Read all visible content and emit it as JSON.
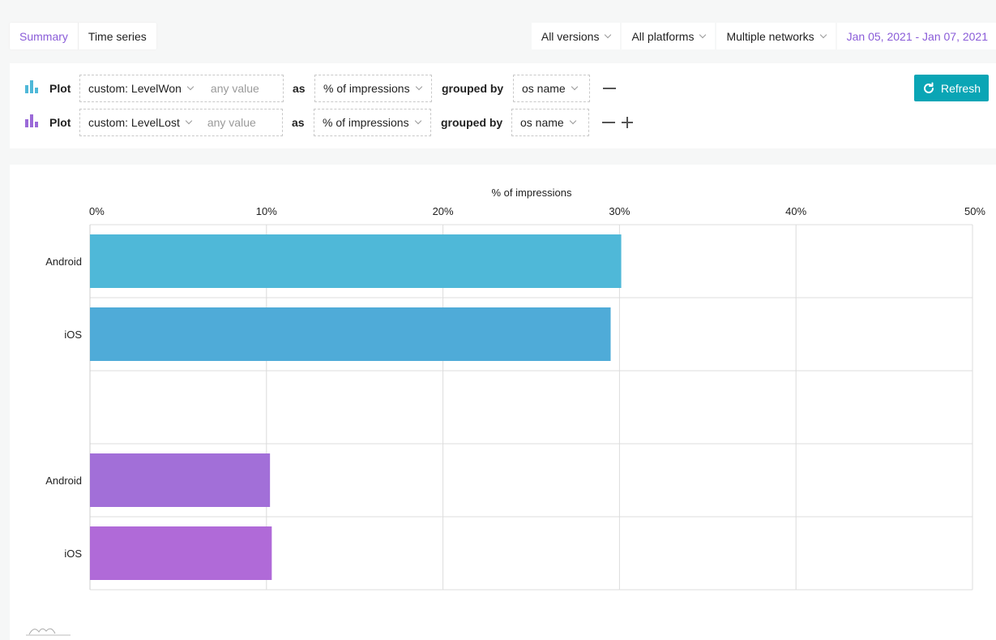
{
  "tabs": [
    {
      "label": "Summary",
      "active": true
    },
    {
      "label": "Time series",
      "active": false
    }
  ],
  "filters": {
    "versions": "All versions",
    "platforms": "All platforms",
    "networks": "Multiple networks",
    "date_range": "Jan 05, 2021 - Jan 07, 2021"
  },
  "query": {
    "rows": [
      {
        "plot_label": "Plot",
        "event": "custom: LevelWon",
        "value_placeholder": "any value",
        "as_label": "as",
        "metric": "% of impressions",
        "grouped_label": "grouped by",
        "group": "os name",
        "icon_color": "#4fb8d8"
      },
      {
        "plot_label": "Plot",
        "event": "custom: LevelLost",
        "value_placeholder": "any value",
        "as_label": "as",
        "metric": "% of impressions",
        "grouped_label": "grouped by",
        "group": "os name",
        "icon_color": "#9b6ad8"
      }
    ],
    "refresh_label": "Refresh"
  },
  "chart_data": {
    "type": "bar",
    "orientation": "horizontal",
    "xlabel": "% of impressions",
    "xlim": [
      0,
      50
    ],
    "xticks": [
      "0%",
      "10%",
      "20%",
      "30%",
      "40%",
      "50%"
    ],
    "grid": true,
    "rows": [
      {
        "label": "Android",
        "value": 30.1,
        "color": "#4fb8d8",
        "group": "custom: LevelWon"
      },
      {
        "label": "iOS",
        "value": 29.5,
        "color": "#4fabd8",
        "group": "custom: LevelWon"
      },
      {
        "label": "",
        "value": null
      },
      {
        "label": "Android",
        "value": 10.2,
        "color": "#a26fd8",
        "group": "custom: LevelLost"
      },
      {
        "label": "iOS",
        "value": 10.3,
        "color": "#b06ad8",
        "group": "custom: LevelLost"
      }
    ]
  }
}
